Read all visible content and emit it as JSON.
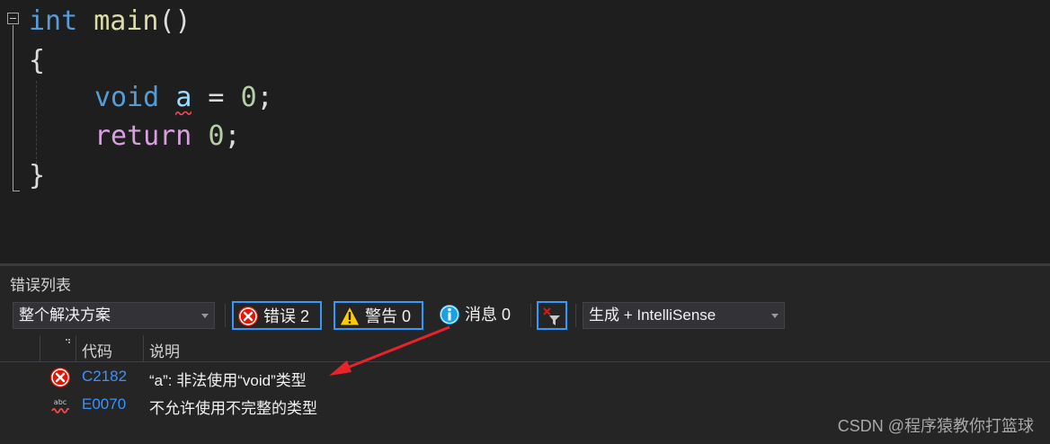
{
  "editor": {
    "line1": {
      "kw": "int",
      "fn": "main",
      "punc": "()"
    },
    "line2": "{",
    "line3": {
      "kw": "void",
      "var": "a",
      "op": " = ",
      "num": "0",
      "end": ";"
    },
    "line4": {
      "kw": "return",
      "num": "0",
      "end": ";"
    },
    "line5": "}"
  },
  "error_list": {
    "title": "错误列表",
    "scope": "整个解决方案",
    "errors_label": "错误 2",
    "warnings_label": "警告 0",
    "messages_label": "消息 0",
    "build_filter": "生成 + IntelliSense",
    "columns": {
      "code": "代码",
      "description": "说明"
    },
    "rows": [
      {
        "icon": "error-icon",
        "code": "C2182",
        "description": "“a”: 非法使用“void”类型"
      },
      {
        "icon": "intellisense-error-icon",
        "code": "E0070",
        "description": "不允许使用不完整的类型"
      }
    ]
  },
  "watermark": "CSDN @程序猿教你打篮球",
  "colors": {
    "keyword": "#569cd6",
    "function": "#dcdcaa",
    "number": "#b5cea8",
    "control": "#d8a0df",
    "link": "#3794ff",
    "accent": "#3399ff",
    "annotation": "#e8232a"
  }
}
